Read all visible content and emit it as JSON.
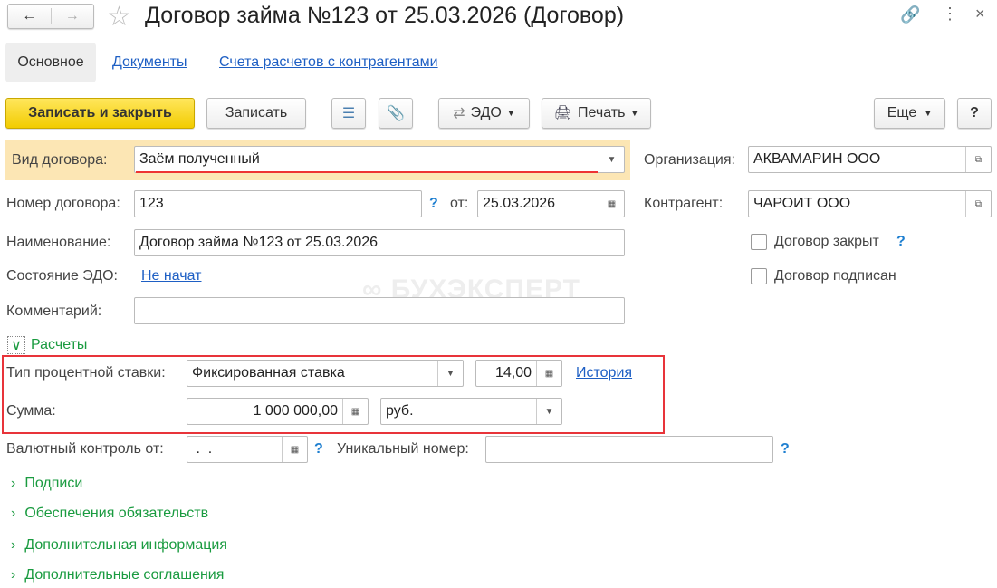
{
  "title": "Договор займа №123 от 25.03.2026 (Договор)",
  "tabs": [
    "Основное",
    "Документы",
    "Счета расчетов с контрагентами"
  ],
  "toolbar": {
    "save_close": "Записать и закрыть",
    "save": "Записать",
    "edo": "ЭДО",
    "print": "Печать",
    "more": "Еще",
    "help": "?"
  },
  "form": {
    "vid_label": "Вид договора:",
    "vid_value": "Заём полученный",
    "nomer_label": "Номер договора:",
    "nomer_value": "123",
    "ot_label": "от:",
    "date_value": "25.03.2026",
    "name_label": "Наименование:",
    "name_value": "Договор займа №123 от 25.03.2026",
    "edo_label": "Состояние ЭДО:",
    "edo_value": "Не начат",
    "comment_label": "Комментарий:",
    "comment_value": "",
    "org_label": "Организация:",
    "org_value": "АКВАМАРИН ООО",
    "kontr_label": "Контрагент:",
    "kontr_value": "ЧАРОИТ ООО",
    "closed_label": "Договор закрыт",
    "signed_label": "Договор подписан",
    "raschety": "Расчеты",
    "rate_type_label": "Тип процентной ставки:",
    "rate_type_value": "Фиксированная ставка",
    "rate_value": "14,00",
    "history": "История",
    "sum_label": "Сумма:",
    "sum_value": "1 000 000,00",
    "currency": "руб.",
    "valcontrol_label": "Валютный контроль от:",
    "valcontrol_value": " .  .",
    "unique_label": "Уникальный номер:",
    "unique_value": "",
    "q": "?"
  },
  "groups": [
    "Подписи",
    "Обеспечения обязательств",
    "Дополнительная информация",
    "Дополнительные соглашения"
  ],
  "watermark": "БУХЭКСПЕРТ"
}
